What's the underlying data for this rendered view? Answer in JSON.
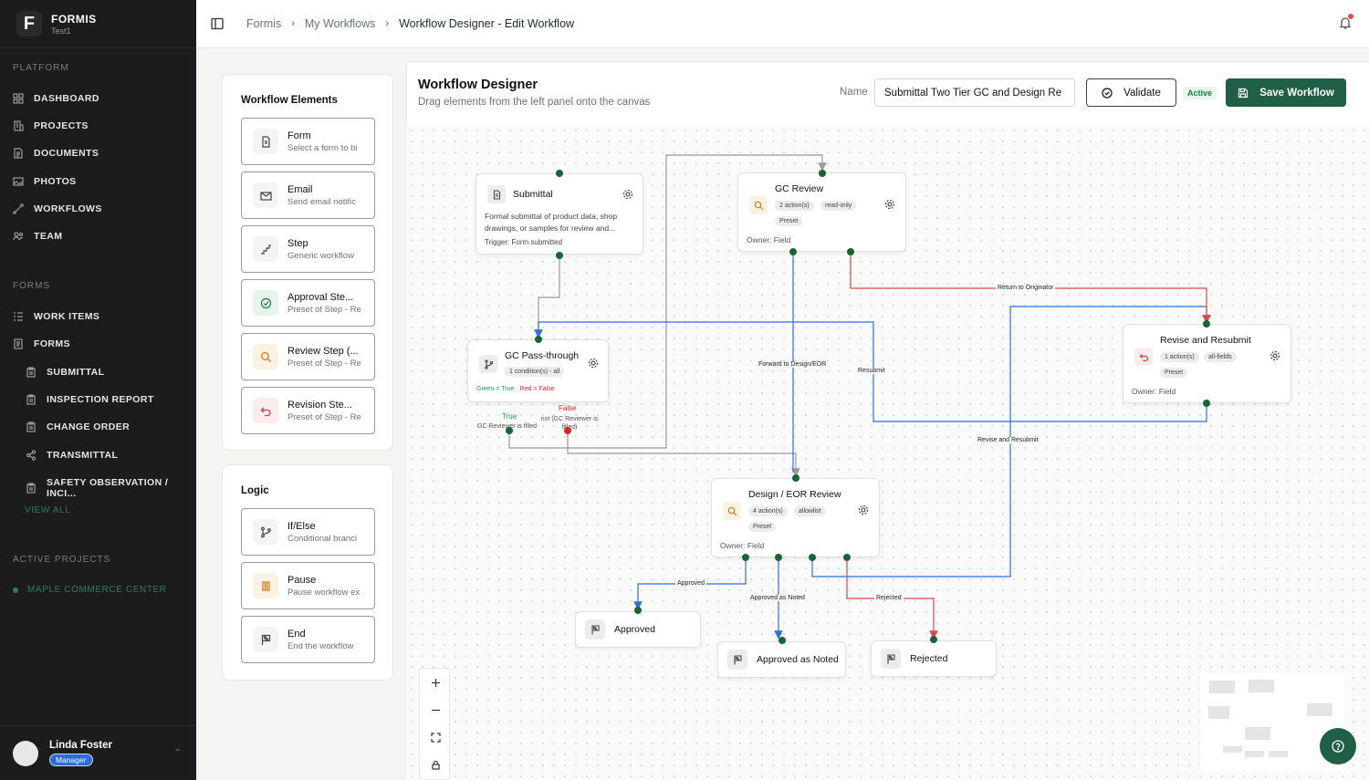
{
  "brand": {
    "name": "FORMIS",
    "sub": "Test1",
    "logo": "F"
  },
  "sidebar": {
    "platform_title": "PLATFORM",
    "platform_items": [
      {
        "label": "DASHBOARD",
        "icon": "grid-icon"
      },
      {
        "label": "PROJECTS",
        "icon": "building-icon"
      },
      {
        "label": "DOCUMENTS",
        "icon": "document-icon"
      },
      {
        "label": "PHOTOS",
        "icon": "image-icon"
      },
      {
        "label": "WORKFLOWS",
        "icon": "workflow-icon"
      },
      {
        "label": "TEAM",
        "icon": "users-icon"
      }
    ],
    "forms_title": "FORMS",
    "forms_items": [
      {
        "label": "WORK ITEMS",
        "icon": "list-icon"
      },
      {
        "label": "FORMS",
        "icon": "form-icon"
      }
    ],
    "form_sub_items": [
      {
        "label": "SUBMITTAL",
        "icon": "clipboard-icon"
      },
      {
        "label": "INSPECTION REPORT",
        "icon": "clipboard-icon"
      },
      {
        "label": "CHANGE ORDER",
        "icon": "clipboard-icon"
      },
      {
        "label": "TRANSMITTAL",
        "icon": "share-icon"
      },
      {
        "label": "SAFETY OBSERVATION / INCI...",
        "icon": "clipboard-icon"
      }
    ],
    "view_all": "VIEW ALL",
    "active_projects_title": "ACTIVE PROJECTS",
    "active_project": "MAPLE COMMERCE CENTER"
  },
  "user": {
    "name": "Linda Foster",
    "role": "Manager"
  },
  "breadcrumb": {
    "items": [
      "Formis",
      "My Workflows",
      "Workflow Designer - Edit Workflow"
    ]
  },
  "header": {
    "title": "Workflow Designer",
    "subtitle": "Drag elements from the left panel onto the canvas",
    "name_label": "Name",
    "name_value": "Submittal Two Tier GC and Design Re",
    "validate_label": "Validate",
    "status": "Active",
    "save_label": "Save Workflow"
  },
  "elements_panel": {
    "title": "Workflow Elements",
    "items": [
      {
        "title": "Form",
        "desc": "Select a form to bi",
        "icon": "document-icon",
        "color": "#f3f4f6"
      },
      {
        "title": "Email",
        "desc": "Send email notific",
        "icon": "mail-icon",
        "color": "#f3f4f6"
      },
      {
        "title": "Step",
        "desc": "Generic workflow",
        "icon": "step-icon",
        "color": "#f3f4f6"
      },
      {
        "title": "Approval Ste...",
        "desc": "Preset of Step - Re",
        "icon": "check-circle-icon",
        "color": "#e6f4ec"
      },
      {
        "title": "Review Step (...",
        "desc": "Preset of Step - Re",
        "icon": "search-icon",
        "color": "#fdf1e4"
      },
      {
        "title": "Revision Ste...",
        "desc": "Preset of Step - Re",
        "icon": "undo-icon",
        "color": "#fdecec"
      }
    ]
  },
  "logic_panel": {
    "title": "Logic",
    "items": [
      {
        "title": "If/Else",
        "desc": "Conditional branci",
        "icon": "branch-icon",
        "color": "#f3f4f6"
      },
      {
        "title": "Pause",
        "desc": "Pause workflow ex",
        "icon": "pause-icon",
        "color": "#fdf1e4"
      },
      {
        "title": "End",
        "desc": "End the workflow",
        "icon": "flag-icon",
        "color": "#f3f4f6"
      }
    ]
  },
  "nodes": {
    "submittal": {
      "title": "Submittal",
      "desc": "Formal submittal of product data, shop drawings, or samples for review and...",
      "trigger": "Trigger: Form submitted"
    },
    "gc_review": {
      "title": "GC Review",
      "chips": [
        "2 action(s)",
        "read-only",
        "Preset"
      ],
      "owner": "Owner: Field"
    },
    "gc_pass": {
      "title": "GC Pass-through",
      "chip": "1 condition(s) - all",
      "legend_green": "Green = True",
      "legend_sep": "·",
      "legend_red": "Red = False",
      "true_label": "True",
      "true_desc": "GC Reviewer is filled",
      "false_label": "False",
      "false_desc": "not (GC Reviewer is filled)"
    },
    "revise": {
      "title": "Revise and Resubmit",
      "chips": [
        "1 action(s)",
        "all-fields",
        "Preset"
      ],
      "owner": "Owner: Field"
    },
    "design": {
      "title": "Design / EOR Review",
      "chips": [
        "4 action(s)",
        "allowlist",
        "Preset"
      ],
      "owner": "Owner: Field"
    },
    "approved": {
      "title": "Approved"
    },
    "approved_noted": {
      "title": "Approved as Noted"
    },
    "rejected": {
      "title": "Rejected"
    }
  },
  "edge_labels": {
    "return": "Return to Originator",
    "forward": "Forward to Design/EOR",
    "resubmit": "Resubmit",
    "revise": "Revise and Resubmit",
    "approved": "Approved",
    "approved_noted": "Approved as Noted",
    "rejected": "Rejected"
  },
  "colors": {
    "accent": "#1f5f45",
    "edge_blue": "#2f6fd6",
    "edge_red": "#e04646",
    "edge_gray": "#9a9a9a",
    "handle": "#166534"
  }
}
